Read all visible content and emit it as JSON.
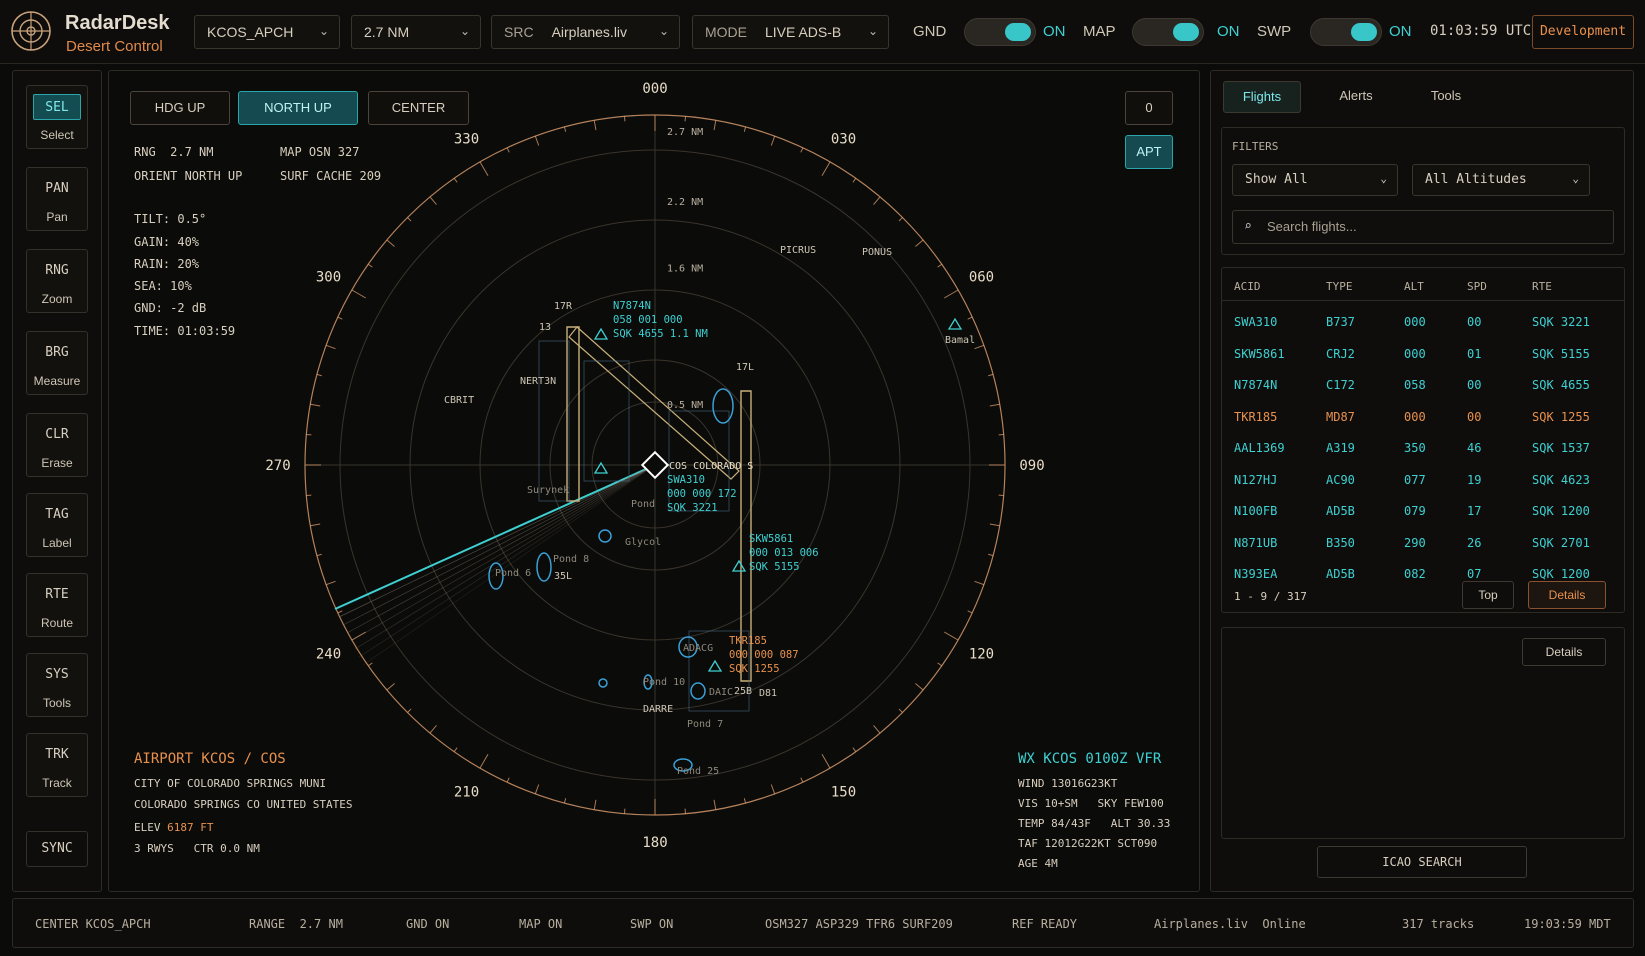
{
  "app": {
    "name": "RadarDesk",
    "subtitle": "Desert Control",
    "environment": "Development",
    "clock": "01:03:59 UTC"
  },
  "header": {
    "facility": "KCOS_APCH",
    "range": "2.7 NM",
    "src": {
      "key": "SRC",
      "value": "Airplanes.liv"
    },
    "mode": {
      "key": "MODE",
      "value": "LIVE ADS-B"
    },
    "toggles": [
      {
        "label": "GND",
        "state": "ON"
      },
      {
        "label": "MAP",
        "state": "ON"
      },
      {
        "label": "SWP",
        "state": "ON"
      }
    ]
  },
  "toolbar": {
    "tools": [
      {
        "code": "SEL",
        "label": "Select",
        "active": true
      },
      {
        "code": "PAN",
        "label": "Pan"
      },
      {
        "code": "RNG",
        "label": "Zoom"
      },
      {
        "code": "BRG",
        "label": "Measure"
      },
      {
        "code": "CLR",
        "label": "Erase"
      },
      {
        "code": "TAG",
        "label": "Label"
      },
      {
        "code": "RTE",
        "label": "Route"
      },
      {
        "code": "SYS",
        "label": "Tools"
      },
      {
        "code": "TRK",
        "label": "Track"
      }
    ],
    "sync": "SYNC"
  },
  "radar": {
    "buttons": {
      "hdg": "HDG UP",
      "north": "NORTH UP",
      "center": "CENTER",
      "count": "0",
      "apt": "APT"
    },
    "info_left": {
      "rng": "RNG  2.7 NM",
      "orient": "ORIENT NORTH UP",
      "map": "MAP OSN 327",
      "surf": "SURF CACHE 209",
      "tilt": "TILT: 0.5°",
      "gain": "GAIN: 40%",
      "rain": "RAIN: 20%",
      "sea": "SEA: 10%",
      "gnd": "GND: -2 dB",
      "time": "TIME: 01:03:59"
    },
    "bearings": [
      "000",
      "030",
      "060",
      "090",
      "120",
      "150",
      "180",
      "210",
      "240",
      "270",
      "300",
      "330"
    ],
    "rings": [
      "2.7 NM",
      "2.2 NM",
      "1.6 NM",
      "0.5 NM"
    ],
    "fixes": [
      "PICRUS",
      "PONUS",
      "CBRIT",
      "NERT3N",
      "Bamal",
      "17R",
      "13",
      "17L",
      "35L",
      "25B",
      "D81",
      "DARRE"
    ],
    "airport_label": "COS COLORADO S",
    "ponds": [
      "Pond 6",
      "Pond 8",
      "Pond 10",
      "Pond 7",
      "Pond 25",
      "Glycol",
      "Surynek",
      "Pond",
      "ADACG",
      "DAIC"
    ],
    "targets": [
      {
        "acid": "N7874N",
        "line2": "058 001 000",
        "line3": "SQK 4655 1.1 NM"
      },
      {
        "acid": "SWA310",
        "line2": "000 000 172",
        "line3": "SQK 3221"
      },
      {
        "acid": "SKW5861",
        "line2": "000 013 006",
        "line3": "SQK 5155"
      },
      {
        "acid": "TKR185",
        "line2": "000 000 087",
        "line3": "SQK 1255"
      }
    ],
    "airport": {
      "title": "AIRPORT KCOS / COS",
      "name": "CITY OF COLORADO SPRINGS MUNI",
      "loc": "COLORADO SPRINGS CO UNITED STATES",
      "elev_k": "ELEV",
      "elev_v": "6187 FT",
      "rwys": "3 RWYS   CTR 0.0 NM"
    },
    "wx": {
      "title": "WX KCOS 0100Z VFR",
      "wind": "WIND 13016G23KT",
      "vis": "VIS 10+SM   SKY FEW100",
      "temp": "TEMP 84/43F   ALT 30.33",
      "taf": "TAF 12012G22KT SCT090",
      "age": "AGE 4M"
    }
  },
  "panel": {
    "tabs": [
      "Flights",
      "Alerts",
      "Tools"
    ],
    "filters": {
      "title": "FILTERS",
      "show": "Show All",
      "alt": "All Altitudes",
      "search_placeholder": "Search flights..."
    },
    "table": {
      "headers": [
        "ACID",
        "TYPE",
        "ALT",
        "SPD",
        "RTE"
      ],
      "rows": [
        [
          "SWA310",
          "B737",
          "000",
          "00",
          "SQK 3221"
        ],
        [
          "SKW5861",
          "CRJ2",
          "000",
          "01",
          "SQK 5155"
        ],
        [
          "N7874N",
          "C172",
          "058",
          "00",
          "SQK 4655"
        ],
        [
          "TKR185",
          "MD87",
          "000",
          "00",
          "SQK 1255"
        ],
        [
          "AAL1369",
          "A319",
          "350",
          "46",
          "SQK 1537"
        ],
        [
          "N127HJ",
          "AC90",
          "077",
          "19",
          "SQK 4623"
        ],
        [
          "N100FB",
          "AD5B",
          "079",
          "17",
          "SQK 1200"
        ],
        [
          "N871UB",
          "B350",
          "290",
          "26",
          "SQK 2701"
        ],
        [
          "N393EA",
          "AD5B",
          "082",
          "07",
          "SQK 1200"
        ]
      ],
      "alert_row": 3,
      "pager": "1 - 9 / 317",
      "top": "Top",
      "details": "Details"
    },
    "details_btn": "Details",
    "icao": "ICAO SEARCH"
  },
  "status": [
    "CENTER KCOS_APCH",
    "RANGE  2.7 NM",
    "GND ON",
    "MAP ON",
    "SWP ON",
    "OSM327 ASP329 TFR6 SURF209",
    "REF READY",
    "Airplanes.liv  Online",
    "317 tracks",
    "19:03:59 MDT"
  ],
  "colors": {
    "accent": "#3fd0d2",
    "warn": "#e8914e",
    "ring": "#e0a070"
  }
}
